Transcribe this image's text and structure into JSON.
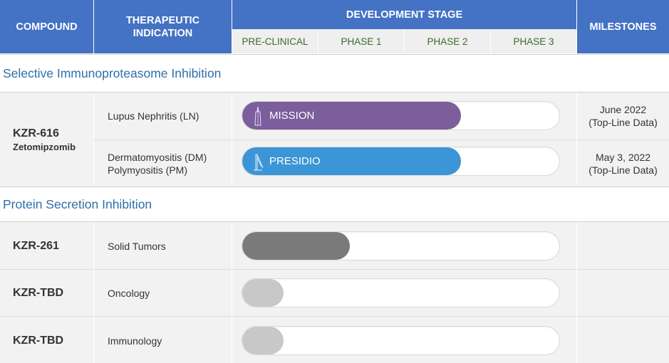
{
  "header": {
    "compound": "COMPOUND",
    "indication_line1": "THERAPEUTIC",
    "indication_line2": "INDICATION",
    "stage": "DEVELOPMENT STAGE",
    "milestones": "MILESTONES",
    "phases": [
      "PRE-CLINICAL",
      "PHASE 1",
      "PHASE 2",
      "PHASE 3"
    ]
  },
  "colors": {
    "header_bg": "#4472c4",
    "section_title": "#2e6fa8",
    "phase_text": "#3a6b2a",
    "mission_bar": "#7b5e9b",
    "presidio_bar": "#3b95d6",
    "kzr261_bar": "#7a7a7a",
    "tbd_bar": "#c8c8c8"
  },
  "sections": [
    {
      "title": "Selective Immunoproteasome Inhibition",
      "compound": "KZR-616",
      "compound_sub": "Zetomipzomib",
      "rows": [
        {
          "indication_line1": "Lupus Nephritis (LN)",
          "indication_line2": "",
          "trial": "MISSION",
          "trial_icon": "tower-icon",
          "progress": 0.69,
          "milestone_line1": "June 2022",
          "milestone_line2": "(Top-Line Data)"
        },
        {
          "indication_line1": "Dermatomyositis (DM)",
          "indication_line2": "Polymyositis (PM)",
          "trial": "PRESIDIO",
          "trial_icon": "bridge-icon",
          "progress": 0.69,
          "milestone_line1": "May 3, 2022",
          "milestone_line2": "(Top-Line Data)"
        }
      ]
    },
    {
      "title": "Protein Secretion Inhibition",
      "rows": [
        {
          "compound": "KZR-261",
          "indication": "Solid Tumors",
          "progress": 0.34
        },
        {
          "compound": "KZR-TBD",
          "indication": "Oncology",
          "progress": 0.13
        },
        {
          "compound": "KZR-TBD",
          "indication": "Immunology",
          "progress": 0.13
        }
      ]
    }
  ]
}
